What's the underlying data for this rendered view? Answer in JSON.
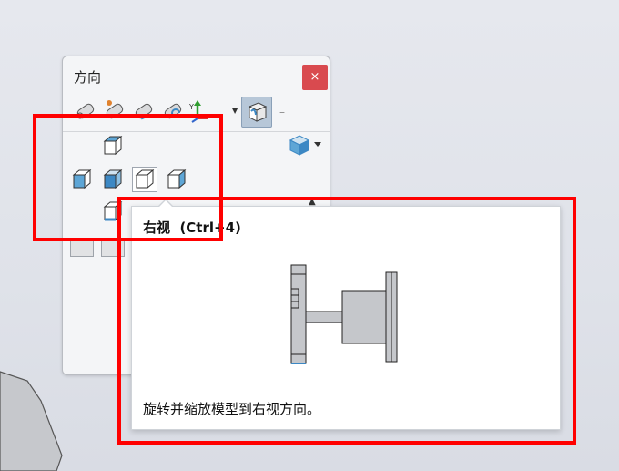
{
  "panel": {
    "title": "方向",
    "close_label": "×"
  },
  "toolbar": {
    "icons": [
      "view-selector-icon",
      "normal-to-icon",
      "link-views-icon",
      "update-standard-views-icon",
      "axis-triad-icon",
      "view-selector-cube-icon"
    ],
    "axis_label": "Y",
    "dash": "–"
  },
  "tooltip": {
    "title": "右视  (Ctrl+4)",
    "description": "旋转并缩放模型到右视方向。"
  },
  "colors": {
    "highlight": "#ff0000",
    "close_bg": "#d94a4f",
    "accent": "#3c88c4"
  }
}
